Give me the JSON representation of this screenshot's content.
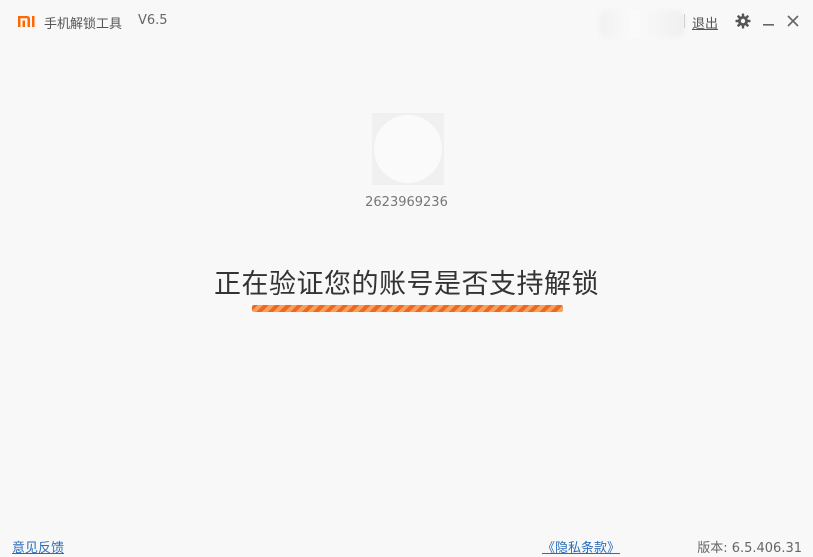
{
  "titlebar": {
    "app_title": "手机解锁工具",
    "version": "V6.5",
    "logout_label": "退出",
    "logo_icon": "mi-logo-icon",
    "settings_icon": "gear-icon",
    "minimize_icon": "minimize-icon",
    "close_icon": "close-icon"
  },
  "account": {
    "id": "2623969236"
  },
  "status": {
    "message": "正在验证您的账号是否支持解锁",
    "progress": 1.0
  },
  "footer": {
    "feedback_label": "意见反馈",
    "privacy_label": "《隐私条款》",
    "version_label": "版本: 6.5.406.31"
  },
  "colors": {
    "brand": "#ff6700",
    "progress": "#f47a28",
    "link": "#2a6ebb"
  }
}
